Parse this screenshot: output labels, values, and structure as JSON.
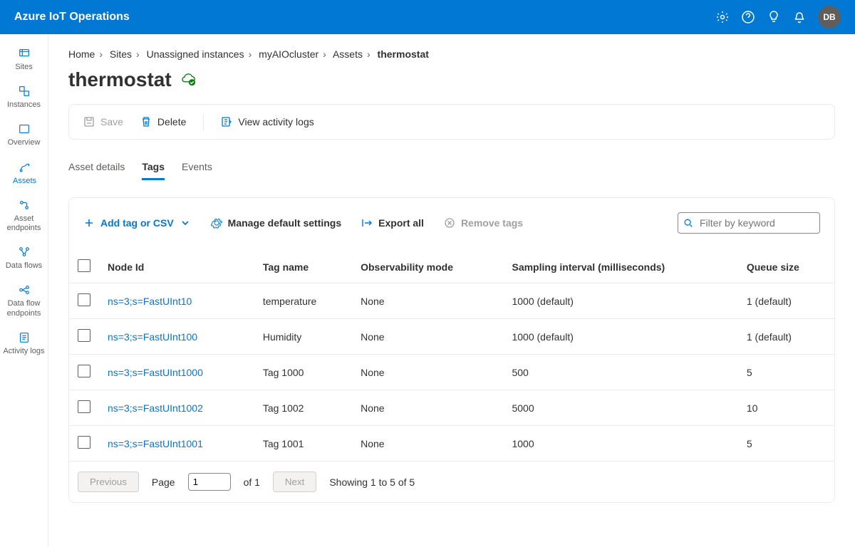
{
  "header": {
    "title": "Azure IoT Operations",
    "avatar_initials": "DB"
  },
  "sidebar": {
    "items": [
      {
        "label": "Sites",
        "icon": "sites"
      },
      {
        "label": "Instances",
        "icon": "instances"
      },
      {
        "label": "Overview",
        "icon": "overview"
      },
      {
        "label": "Assets",
        "icon": "assets",
        "active": true
      },
      {
        "label": "Asset endpoints",
        "icon": "asset-endpoints"
      },
      {
        "label": "Data flows",
        "icon": "data-flows"
      },
      {
        "label": "Data flow endpoints",
        "icon": "df-endpoints"
      },
      {
        "label": "Activity logs",
        "icon": "activity-logs"
      }
    ]
  },
  "breadcrumb": {
    "items": [
      "Home",
      "Sites",
      "Unassigned instances",
      "myAIOcluster",
      "Assets",
      "thermostat"
    ]
  },
  "page": {
    "title": "thermostat"
  },
  "action_bar": {
    "save": "Save",
    "delete": "Delete",
    "view_logs": "View activity logs"
  },
  "tabs": {
    "items": [
      "Asset details",
      "Tags",
      "Events"
    ],
    "active_index": 1
  },
  "toolbar": {
    "add": "Add tag or CSV",
    "manage": "Manage default settings",
    "export": "Export all",
    "remove": "Remove tags",
    "filter_placeholder": "Filter by keyword"
  },
  "table": {
    "columns": [
      "Node Id",
      "Tag name",
      "Observability mode",
      "Sampling interval (milliseconds)",
      "Queue size"
    ],
    "rows": [
      {
        "node_id": "ns=3;s=FastUInt10",
        "tag_name": "temperature",
        "obs_mode": "None",
        "sampling": "1000 (default)",
        "queue": "1 (default)"
      },
      {
        "node_id": "ns=3;s=FastUInt100",
        "tag_name": "Humidity",
        "obs_mode": "None",
        "sampling": "1000 (default)",
        "queue": "1 (default)"
      },
      {
        "node_id": "ns=3;s=FastUInt1000",
        "tag_name": "Tag 1000",
        "obs_mode": "None",
        "sampling": "500",
        "queue": "5"
      },
      {
        "node_id": "ns=3;s=FastUInt1002",
        "tag_name": "Tag 1002",
        "obs_mode": "None",
        "sampling": "5000",
        "queue": "10"
      },
      {
        "node_id": "ns=3;s=FastUInt1001",
        "tag_name": "Tag 1001",
        "obs_mode": "None",
        "sampling": "1000",
        "queue": "5"
      }
    ]
  },
  "pager": {
    "previous": "Previous",
    "next": "Next",
    "page_label": "Page",
    "page_value": "1",
    "of_label": "of 1",
    "showing": "Showing 1 to 5 of 5"
  }
}
